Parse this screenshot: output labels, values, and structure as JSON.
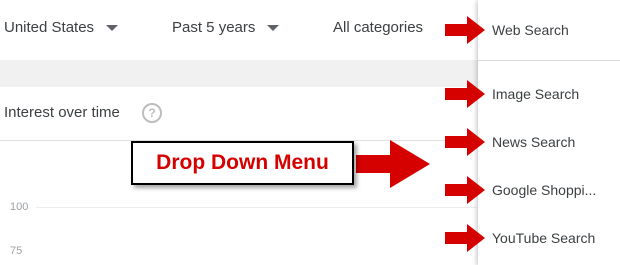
{
  "filters": {
    "country": "United States",
    "period": "Past 5 years",
    "category": "All categories"
  },
  "section": {
    "title": "Interest over time",
    "help_symbol": "?"
  },
  "chart": {
    "y_ticks": [
      "100",
      "75"
    ]
  },
  "menu": {
    "items": [
      "Web Search",
      "Image Search",
      "News Search",
      "Google Shoppi...",
      "YouTube Search"
    ]
  },
  "annotation": {
    "label": "Drop Down Menu",
    "color": "#d50000"
  },
  "icons": {
    "arrow": "right-arrow-icon",
    "dropdown": "caret-down-icon"
  }
}
